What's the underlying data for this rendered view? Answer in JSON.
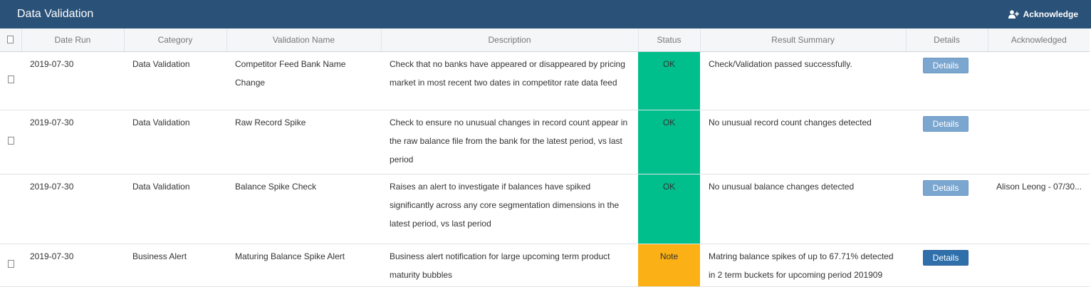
{
  "header": {
    "title": "Data Validation",
    "acknowledge_label": "Acknowledge"
  },
  "table": {
    "columns": [
      "",
      "Date Run",
      "Category",
      "Validation Name",
      "Description",
      "Status",
      "Result Summary",
      "Details",
      "Acknowledged"
    ],
    "rows": [
      {
        "date_run": "2019-07-30",
        "category": "Data Validation",
        "validation_name": "Competitor Feed Bank Name Change",
        "description": "Check that no banks have appeared or disappeared by pricing market in most recent two dates in competitor rate data feed",
        "status": "OK",
        "result_summary": "Check/Validation passed successfully.",
        "details_label": "Details",
        "acknowledged": ""
      },
      {
        "date_run": "2019-07-30",
        "category": "Data Validation",
        "validation_name": "Raw Record Spike",
        "description": "Check to ensure no unusual changes in record count appear in the raw balance file from the bank for the latest period, vs last period",
        "status": "OK",
        "result_summary": "No unusual record count changes detected",
        "details_label": "Details",
        "acknowledged": ""
      },
      {
        "date_run": "2019-07-30",
        "category": "Data Validation",
        "validation_name": "Balance Spike Check",
        "description": "Raises an alert to investigate if balances have spiked significantly across any core segmentation dimensions in the latest period, vs last period",
        "status": "OK",
        "result_summary": "No unusual balance changes detected",
        "details_label": "Details",
        "acknowledged": "Alison Leong - 07/30..."
      },
      {
        "date_run": "2019-07-30",
        "category": "Business Alert",
        "validation_name": "Maturing Balance Spike Alert",
        "description": "Business alert notification for large upcoming term product maturity bubbles",
        "status": "Note",
        "result_summary": "Matring balance spikes of up to 67.71% detected in 2 term buckets for upcoming period 201909",
        "details_label": "Details",
        "acknowledged": ""
      }
    ]
  },
  "colors": {
    "header_bg": "#2a5178",
    "status_ok": "#00bf8c",
    "status_note": "#fbb116",
    "details_button": "#7ba6cf",
    "details_button_active": "#2f6faa"
  },
  "icons": {
    "acknowledge": "user-plus-icon",
    "row_select": "checkbox-icon"
  }
}
